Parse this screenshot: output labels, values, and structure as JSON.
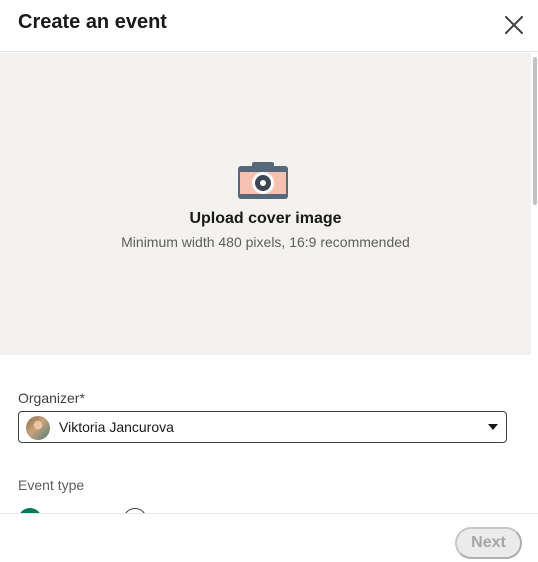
{
  "header": {
    "title": "Create an event",
    "close_icon": "close-icon"
  },
  "cover": {
    "icon": "camera-icon",
    "title": "Upload cover image",
    "subtitle": "Minimum width 480 pixels, 16:9 recommended"
  },
  "form": {
    "organizer_label": "Organizer*",
    "organizer_value": "Viktoria Jancurova",
    "event_type_label": "Event type"
  },
  "footer": {
    "next_label": "Next"
  },
  "colors": {
    "accent_green": "#0a7759",
    "camera_pink": "#f5c1b1",
    "camera_blue": "#56687a",
    "cover_bg": "#f3f2ef"
  }
}
